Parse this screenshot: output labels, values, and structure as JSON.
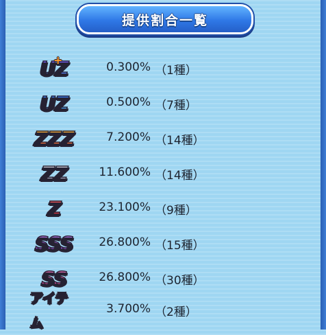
{
  "title": "提供割合一覧",
  "rows": [
    {
      "rank": "UZ",
      "plus": "+",
      "rate": "0.300%",
      "count": "（1種）",
      "colors": [
        "#8f4dff",
        "#3fa0ff"
      ]
    },
    {
      "rank": "UZ",
      "plus": "",
      "rate": "0.500%",
      "count": "（7種）",
      "colors": [
        "#2f6cff",
        "#54c8ff"
      ]
    },
    {
      "rank": "ZZZ",
      "plus": "",
      "rate": "7.200%",
      "count": "（14種）",
      "colors": [
        "#ffd23a",
        "#ff4a3a"
      ]
    },
    {
      "rank": "ZZ",
      "plus": "",
      "rate": "11.600%",
      "count": "（14種）",
      "colors": [
        "#e8e8f0",
        "#8a8aa6"
      ]
    },
    {
      "rank": "Z",
      "plus": "",
      "rate": "23.100%",
      "count": "（9種）",
      "colors": [
        "#ff6a6a",
        "#d81f2f"
      ]
    },
    {
      "rank": "SSS",
      "plus": "",
      "rate": "26.800%",
      "count": "（15種）",
      "colors": [
        "#d48cff",
        "#8a3de0"
      ]
    },
    {
      "rank": "SS",
      "plus": "",
      "rate": "26.800%",
      "count": "（30種）",
      "colors": [
        "#ff8ad0",
        "#e0338f"
      ]
    },
    {
      "rank": "アイテム",
      "plus": "",
      "rate": "3.700%",
      "count": "（2種）",
      "colors": [
        "#ffffff",
        "#ffffff"
      ]
    }
  ]
}
